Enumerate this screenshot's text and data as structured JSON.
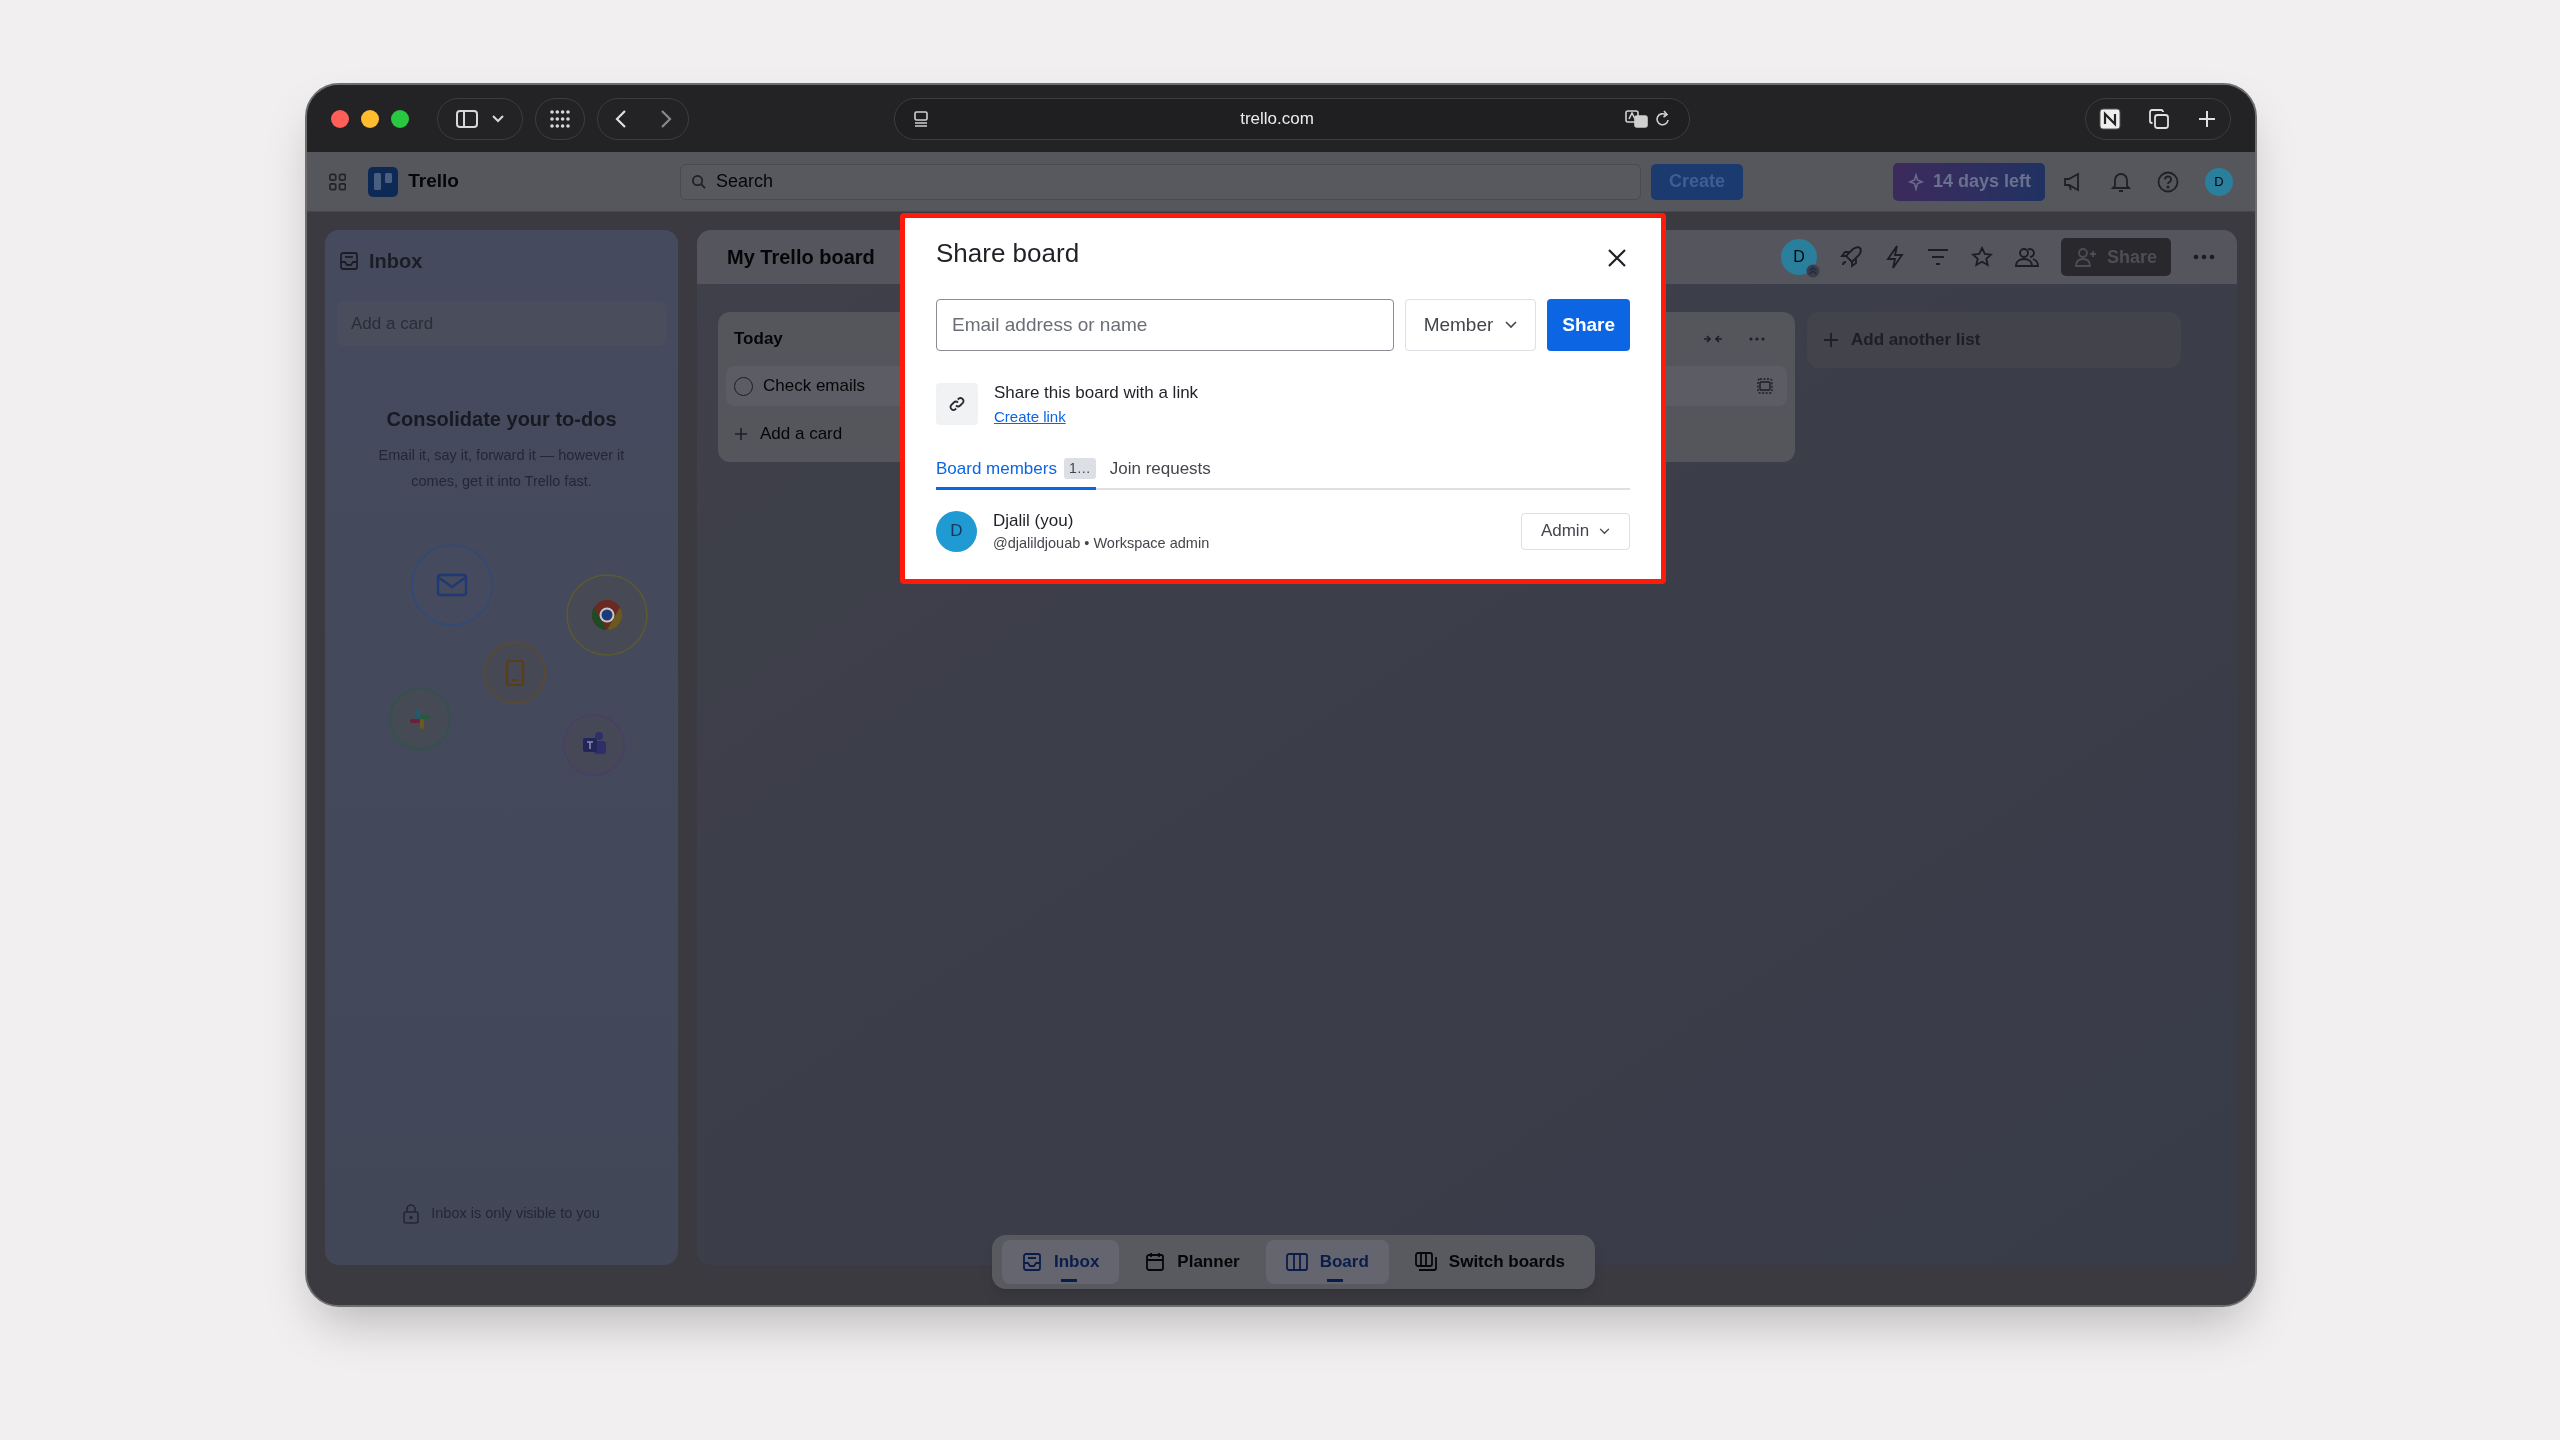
{
  "browser": {
    "url": "trello.com"
  },
  "header": {
    "app_name": "Trello",
    "search_placeholder": "Search",
    "create_button": "Create",
    "trial_badge": "14 days left",
    "avatar_initial": "D"
  },
  "inbox": {
    "title": "Inbox",
    "add_card_placeholder": "Add a card",
    "heading": "Consolidate your to-dos",
    "description": "Email it, say it, forward it — however it comes, get it into Trello fast.",
    "privacy_note": "Inbox is only visible to you"
  },
  "board": {
    "title": "My Trello board",
    "member_initial": "D",
    "share_button": "Share",
    "lists": [
      {
        "title": "Today",
        "cards": [
          {
            "title": "Check emails",
            "completed": false
          }
        ],
        "add_card": "Add a card"
      }
    ],
    "add_list": "Add another list"
  },
  "bottom_nav": [
    {
      "label": "Inbox",
      "selected": true
    },
    {
      "label": "Planner",
      "selected": false
    },
    {
      "label": "Board",
      "selected": true
    },
    {
      "label": "Switch boards",
      "selected": false
    }
  ],
  "dialog": {
    "title": "Share board",
    "email_placeholder": "Email address or name",
    "role_select": "Member",
    "share_button": "Share",
    "link_heading": "Share this board with a link",
    "create_link": "Create link",
    "tabs": [
      {
        "label": "Board members",
        "count": "1…",
        "selected": true
      },
      {
        "label": "Join requests",
        "selected": false
      }
    ],
    "members": [
      {
        "initial": "D",
        "name": "Djalil (you)",
        "details": "@djalildjouab • Workspace admin",
        "role": "Admin"
      }
    ]
  }
}
